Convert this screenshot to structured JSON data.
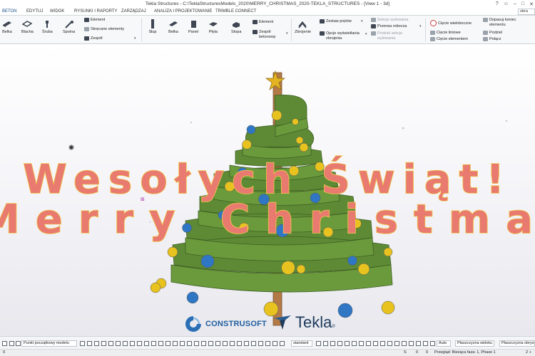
{
  "window": {
    "title": "Tekla Structures - C:\\TeklaStructuresModels_2020\\MERRY_CHRISTMAS_2020-TEKLA_STRUCTURES - [View 1 - 3d]",
    "help": "?",
    "user_initial": "☺",
    "minimize": "–",
    "maximize": "□",
    "close": "✕"
  },
  "menu": {
    "tabs": [
      "BETON",
      "EDYTUJ",
      "WIDOK",
      "RYSUNKI I RAPORTY",
      "ZARZĄDZAJ",
      "ANALIZA I PROJEKTOWANIE",
      "TRIMBLE CONNECT"
    ],
    "active_tab": "BETON",
    "search_value": "obra"
  },
  "ribbon": {
    "belka": "Belka",
    "blacha": "Blacha",
    "sruba": "Śruba",
    "spoina": "Spoina",
    "element": "Element",
    "skrecane": "Skręcane elementy",
    "zespol": "Zespół",
    "slup": "Słup",
    "belka2": "Belka",
    "panel": "Panel",
    "plyta": "Płyta",
    "stopa": "Stopa",
    "element2": "Element",
    "zespol_betonowy_1": "Zespół",
    "zespol_betonowy_2": "betonowy",
    "zbrojenie": "Zbrojenie",
    "zestaw_pretow": "Zestaw prętów",
    "opcje_1": "Opcje wyświetlania",
    "opcje_2": "zbrojenia",
    "sekcje": "Sekcje wylewania",
    "przerwa": "Przerwa robocza",
    "podziel_1": "Podziel sekcje",
    "podziel_2": "wylewania",
    "ciecie_wieloboczne": "Cięcie wieloboczne",
    "ciecie_liniowe": "Cięcie liniowe",
    "ciecie_elementem": "Cięcie elementem",
    "dopasuj_1": "Dopasuj koniec",
    "dopasuj_2": "elementu",
    "podziel": "Podziel",
    "polacz": "Połącz"
  },
  "viewport": {
    "greeting_pl": "Wesołych Świąt!",
    "greeting_en": "Merry Christmas",
    "logo_construsoft": "CONSTRUSOFT",
    "logo_tekla": "Tekla",
    "logo_tekla_mark": "®"
  },
  "statusbar": {
    "snap_point": "Punkt początkowy modelu",
    "standard": "standard",
    "auto": "Auto",
    "plane1": "Płaszczyzna widoku",
    "plane2": "Płaszczyzna obrysu"
  },
  "infobar": {
    "value_left": "0",
    "s": "S",
    "zero1": "0",
    "zero2": "0",
    "status": "Przegląd: Bieżąca faza: 1, Phase 1",
    "page": "2 +"
  },
  "colors": {
    "tree_green": "#6a9a3c",
    "ornament_gold": "#e8c21e",
    "ornament_blue": "#2f76c4",
    "star": "#e3b321",
    "trunk": "#b37a48",
    "greeting_fill": "#e97a6f",
    "greeting_stroke": "#f1c84b"
  }
}
